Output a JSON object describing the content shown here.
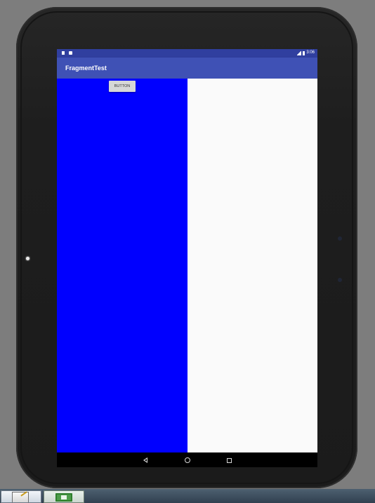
{
  "device": {
    "name": "Android tablet emulator"
  },
  "status_bar": {
    "time": "3:06",
    "icons": [
      "sd-card-icon",
      "download-icon",
      "signal-icon",
      "battery-icon"
    ]
  },
  "app_bar": {
    "title": "FragmentTest"
  },
  "fragments": {
    "left": {
      "button_label": "BUTTON",
      "background": "#0000ff"
    },
    "right": {
      "background": "#fafafa"
    }
  },
  "nav_bar": {
    "buttons": [
      "back-icon",
      "home-icon",
      "recent-apps-icon"
    ]
  },
  "taskbar": {
    "items": [
      "notepad-plus-plus-icon",
      "android-studio-icon"
    ]
  },
  "colors": {
    "status_bar": "#303f9f",
    "app_bar": "#3f51b5",
    "nav_bar": "#000000"
  }
}
